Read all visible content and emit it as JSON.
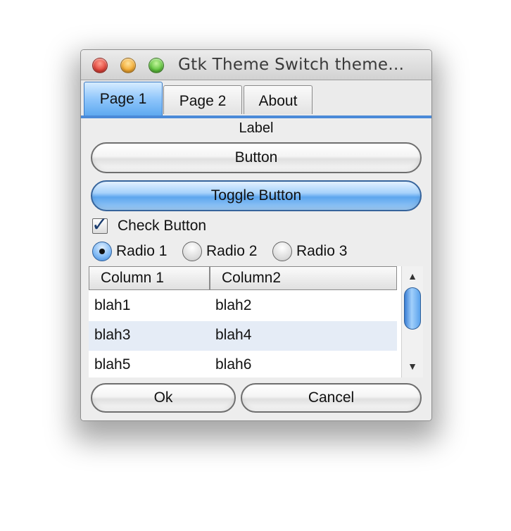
{
  "window": {
    "title": "Gtk Theme Switch theme..."
  },
  "tabs": [
    {
      "label": "Page 1",
      "active": true
    },
    {
      "label": "Page 2",
      "active": false
    },
    {
      "label": "About",
      "active": false
    }
  ],
  "page": {
    "label": "Label",
    "button_label": "Button",
    "toggle_label": "Toggle Button",
    "toggle_active": true,
    "check_label": "Check Button",
    "check_checked": true,
    "radios": [
      {
        "label": "Radio 1",
        "selected": true
      },
      {
        "label": "Radio 2",
        "selected": false
      },
      {
        "label": "Radio 3",
        "selected": false
      }
    ],
    "table": {
      "columns": [
        "Column 1",
        "Column2"
      ],
      "rows": [
        [
          "blah1",
          "blah2"
        ],
        [
          "blah3",
          "blah4"
        ],
        [
          "blah5",
          "blah6"
        ]
      ]
    },
    "ok_label": "Ok",
    "cancel_label": "Cancel"
  },
  "colors": {
    "accent": "#5da6ee",
    "selected_row": "#e5ecf6"
  }
}
